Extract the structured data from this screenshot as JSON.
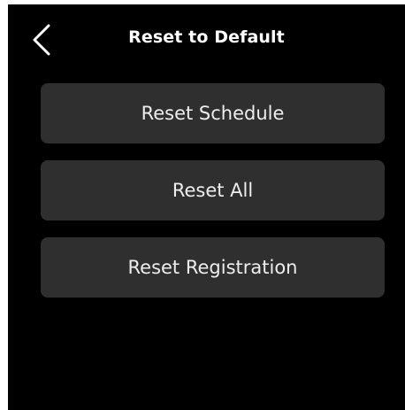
{
  "header": {
    "title": "Reset to Default",
    "back_icon": "chevron-left-icon"
  },
  "options": [
    {
      "label": "Reset Schedule"
    },
    {
      "label": "Reset All"
    },
    {
      "label": "Reset Registration"
    }
  ],
  "colors": {
    "screen_background": "#000000",
    "button_background": "#2f2f2f",
    "text": "#ffffff"
  }
}
